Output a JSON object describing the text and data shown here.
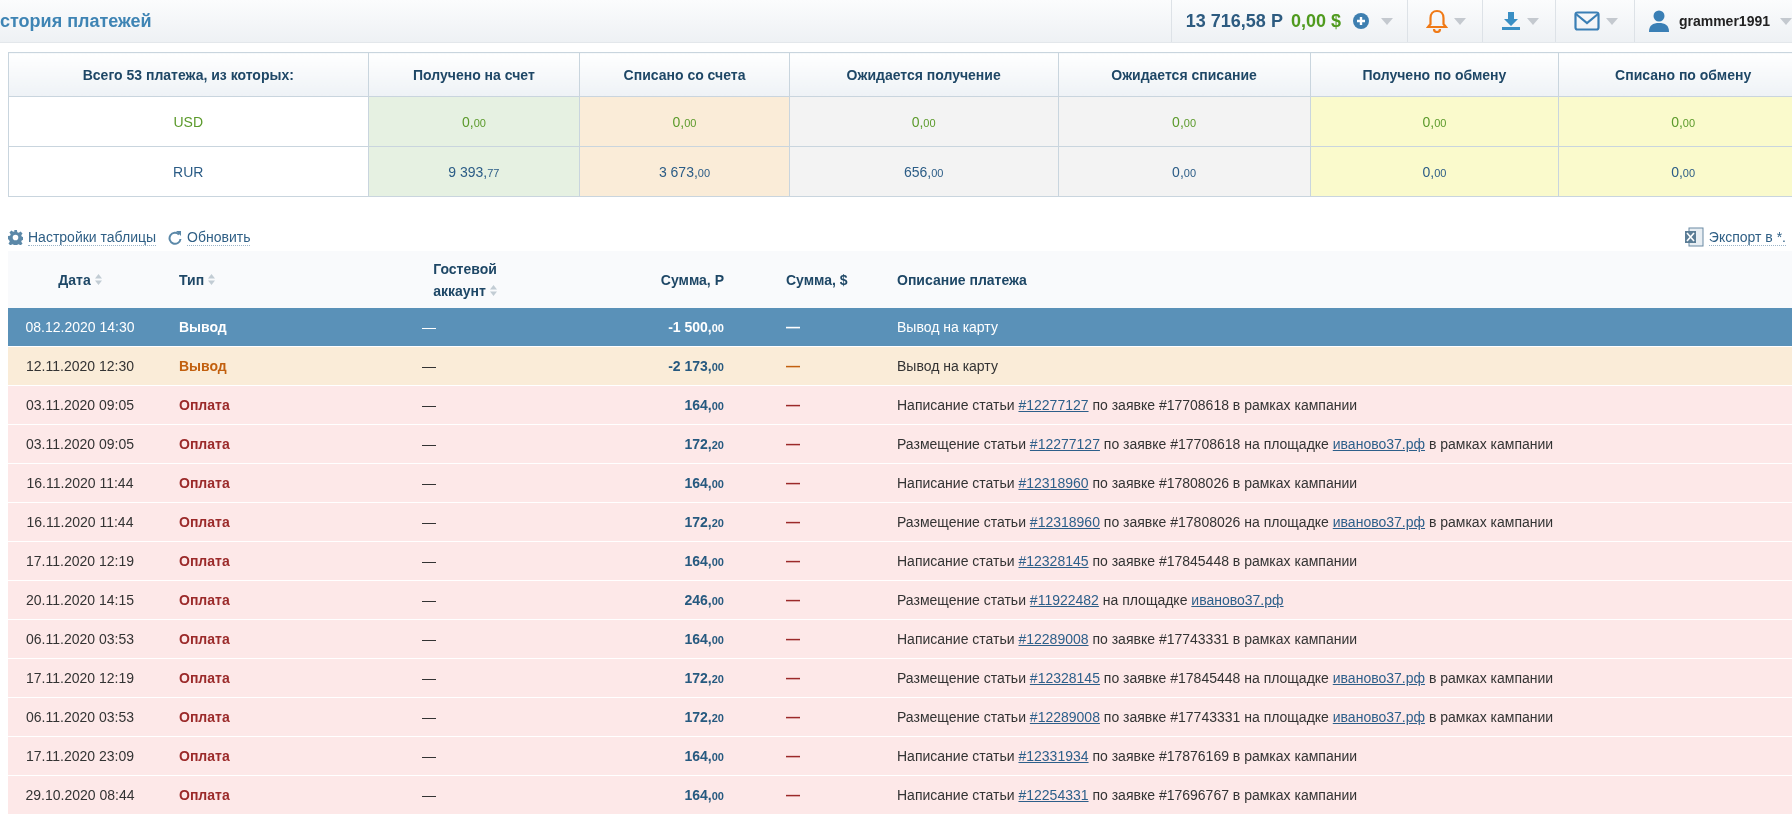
{
  "header": {
    "title": "стория платежей",
    "balance_rub": "13 716,58 Р",
    "balance_usd": "0,00 $",
    "username": "grammer1991"
  },
  "summary": {
    "columns": [
      {
        "label": "Всего 53 платежа, из которых:",
        "kind": "label"
      },
      {
        "label": "Получено на счет",
        "kind": "received"
      },
      {
        "label": "Списано со счета",
        "kind": "withdrawn"
      },
      {
        "label": "Ожидается получение",
        "kind": "pending"
      },
      {
        "label": "Ожидается списание",
        "kind": "pending"
      },
      {
        "label": "Получено по обмену",
        "kind": "exchange"
      },
      {
        "label": "Списано по обмену",
        "kind": "exchange"
      }
    ],
    "rows": [
      {
        "currency": "USD",
        "kind": "usd",
        "values": [
          "0,00",
          "0,00",
          "0,00",
          "0,00",
          "0,00",
          "0,00"
        ]
      },
      {
        "currency": "RUR",
        "kind": "rur",
        "values": [
          "9 393,77",
          "3 673,00",
          "656,00",
          "0,00",
          "0,00",
          "0,00"
        ]
      }
    ]
  },
  "toolbar": {
    "settings": "Настройки таблицы",
    "refresh": "Обновить",
    "export": "Экспорт в *."
  },
  "table": {
    "columns": [
      {
        "label": "Дата",
        "sortable": true
      },
      {
        "label": "Тип",
        "sortable": true
      },
      {
        "label": "Гостевой аккаунт",
        "sortable": true
      },
      {
        "label": "Сумма, Р",
        "sortable": false
      },
      {
        "label": "Сумма, $",
        "sortable": false
      },
      {
        "label": "Описание платежа",
        "sortable": false
      }
    ],
    "rows": [
      {
        "selected": true,
        "kind": "withdrawal",
        "date": "08.12.2020 14:30",
        "type": "Вывод",
        "guest": "—",
        "sum_rub": "-1 500,00",
        "sum_usd": "—",
        "description": [
          {
            "kind": "text",
            "text": "Вывод на карту"
          }
        ]
      },
      {
        "selected": false,
        "kind": "withdrawal",
        "date": "12.11.2020 12:30",
        "type": "Вывод",
        "guest": "—",
        "sum_rub": "-2 173,00",
        "sum_usd": "—",
        "description": [
          {
            "kind": "text",
            "text": "Вывод на карту"
          }
        ]
      },
      {
        "selected": false,
        "kind": "payment",
        "date": "03.11.2020 09:05",
        "type": "Оплата",
        "guest": "—",
        "sum_rub": "164,00",
        "sum_usd": "—",
        "description": [
          {
            "kind": "text",
            "text": "Написание статьи "
          },
          {
            "kind": "link",
            "text": "#12277127"
          },
          {
            "kind": "text",
            "text": " по заявке #17708618 в рамках кампании"
          }
        ]
      },
      {
        "selected": false,
        "kind": "payment",
        "date": "03.11.2020 09:05",
        "type": "Оплата",
        "guest": "—",
        "sum_rub": "172,20",
        "sum_usd": "—",
        "description": [
          {
            "kind": "text",
            "text": "Размещение статьи "
          },
          {
            "kind": "link",
            "text": "#12277127"
          },
          {
            "kind": "text",
            "text": " по заявке #17708618 на площадке "
          },
          {
            "kind": "link",
            "text": "иваново37.рф"
          },
          {
            "kind": "text",
            "text": " в рамках кампании"
          }
        ]
      },
      {
        "selected": false,
        "kind": "payment",
        "date": "16.11.2020 11:44",
        "type": "Оплата",
        "guest": "—",
        "sum_rub": "164,00",
        "sum_usd": "—",
        "description": [
          {
            "kind": "text",
            "text": "Написание статьи "
          },
          {
            "kind": "link",
            "text": "#12318960"
          },
          {
            "kind": "text",
            "text": " по заявке #17808026 в рамках кампании"
          }
        ]
      },
      {
        "selected": false,
        "kind": "payment",
        "date": "16.11.2020 11:44",
        "type": "Оплата",
        "guest": "—",
        "sum_rub": "172,20",
        "sum_usd": "—",
        "description": [
          {
            "kind": "text",
            "text": "Размещение статьи "
          },
          {
            "kind": "link",
            "text": "#12318960"
          },
          {
            "kind": "text",
            "text": " по заявке #17808026 на площадке "
          },
          {
            "kind": "link",
            "text": "иваново37.рф"
          },
          {
            "kind": "text",
            "text": " в рамках кампании"
          }
        ]
      },
      {
        "selected": false,
        "kind": "payment",
        "date": "17.11.2020 12:19",
        "type": "Оплата",
        "guest": "—",
        "sum_rub": "164,00",
        "sum_usd": "—",
        "description": [
          {
            "kind": "text",
            "text": "Написание статьи "
          },
          {
            "kind": "link",
            "text": "#12328145"
          },
          {
            "kind": "text",
            "text": " по заявке #17845448 в рамках кампании"
          }
        ]
      },
      {
        "selected": false,
        "kind": "payment",
        "date": "20.11.2020 14:15",
        "type": "Оплата",
        "guest": "—",
        "sum_rub": "246,00",
        "sum_usd": "—",
        "description": [
          {
            "kind": "text",
            "text": "Размещение статьи "
          },
          {
            "kind": "link",
            "text": "#11922482"
          },
          {
            "kind": "text",
            "text": " на площадке "
          },
          {
            "kind": "link",
            "text": "иваново37.рф"
          }
        ]
      },
      {
        "selected": false,
        "kind": "payment",
        "date": "06.11.2020 03:53",
        "type": "Оплата",
        "guest": "—",
        "sum_rub": "164,00",
        "sum_usd": "—",
        "description": [
          {
            "kind": "text",
            "text": "Написание статьи "
          },
          {
            "kind": "link",
            "text": "#12289008"
          },
          {
            "kind": "text",
            "text": " по заявке #17743331 в рамках кампании"
          }
        ]
      },
      {
        "selected": false,
        "kind": "payment",
        "date": "17.11.2020 12:19",
        "type": "Оплата",
        "guest": "—",
        "sum_rub": "172,20",
        "sum_usd": "—",
        "description": [
          {
            "kind": "text",
            "text": "Размещение статьи "
          },
          {
            "kind": "link",
            "text": "#12328145"
          },
          {
            "kind": "text",
            "text": " по заявке #17845448 на площадке "
          },
          {
            "kind": "link",
            "text": "иваново37.рф"
          },
          {
            "kind": "text",
            "text": " в рамках кампании"
          }
        ]
      },
      {
        "selected": false,
        "kind": "payment",
        "date": "06.11.2020 03:53",
        "type": "Оплата",
        "guest": "—",
        "sum_rub": "172,20",
        "sum_usd": "—",
        "description": [
          {
            "kind": "text",
            "text": "Размещение статьи "
          },
          {
            "kind": "link",
            "text": "#12289008"
          },
          {
            "kind": "text",
            "text": " по заявке #17743331 на площадке "
          },
          {
            "kind": "link",
            "text": "иваново37.рф"
          },
          {
            "kind": "text",
            "text": " в рамках кампании"
          }
        ]
      },
      {
        "selected": false,
        "kind": "payment",
        "date": "17.11.2020 23:09",
        "type": "Оплата",
        "guest": "—",
        "sum_rub": "164,00",
        "sum_usd": "—",
        "description": [
          {
            "kind": "text",
            "text": "Написание статьи "
          },
          {
            "kind": "link",
            "text": "#12331934"
          },
          {
            "kind": "text",
            "text": " по заявке #17876169 в рамках кампании"
          }
        ]
      },
      {
        "selected": false,
        "kind": "payment",
        "date": "29.10.2020 08:44",
        "type": "Оплата",
        "guest": "—",
        "sum_rub": "164,00",
        "sum_usd": "—",
        "description": [
          {
            "kind": "text",
            "text": "Написание статьи "
          },
          {
            "kind": "link",
            "text": "#12254331"
          },
          {
            "kind": "text",
            "text": " по заявке #17696767 в рамках кампании"
          }
        ]
      }
    ]
  }
}
